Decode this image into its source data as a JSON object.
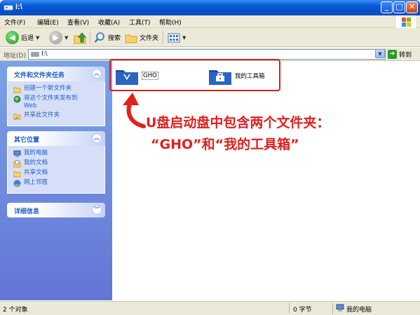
{
  "window": {
    "title": "I:\\"
  },
  "menu": {
    "items": [
      "文件(F)",
      "编辑(E)",
      "查看(V)",
      "收藏(A)",
      "工具(T)",
      "帮助(H)"
    ]
  },
  "toolbar": {
    "back_label": "后退",
    "search_label": "搜索",
    "folders_label": "文件夹"
  },
  "address": {
    "label": "地址(D)",
    "value": "I:\\",
    "go_label": "转到"
  },
  "tasks_panel": {
    "title": "文件和文件夹任务",
    "items": [
      {
        "label": "创建一个新文件夹",
        "icon": "new-folder-icon"
      },
      {
        "label": "将这个文件夹发布到",
        "label2": "Web",
        "icon": "publish-web-icon"
      },
      {
        "label": "共享此文件夹",
        "icon": "share-folder-icon"
      }
    ]
  },
  "places_panel": {
    "title": "其它位置",
    "items": [
      {
        "label": "我的电脑",
        "icon": "my-computer-icon"
      },
      {
        "label": "我的文档",
        "icon": "my-documents-icon"
      },
      {
        "label": "共享文档",
        "icon": "shared-documents-icon"
      },
      {
        "label": "网上邻居",
        "icon": "network-places-icon"
      }
    ]
  },
  "details_panel": {
    "title": "详细信息"
  },
  "files": [
    {
      "name": "GHO",
      "icon": "folder-icon"
    },
    {
      "name": "我的工具箱",
      "icon": "toolbox-folder-icon"
    }
  ],
  "annotation": {
    "line1": "U盘启动盘中包含两个文件夹：",
    "line2": "“GHO”和“我的工具箱”",
    "color": "#e2201f"
  },
  "status": {
    "objects": "2 个对象",
    "size": "0 字节",
    "location": "我的电脑"
  }
}
